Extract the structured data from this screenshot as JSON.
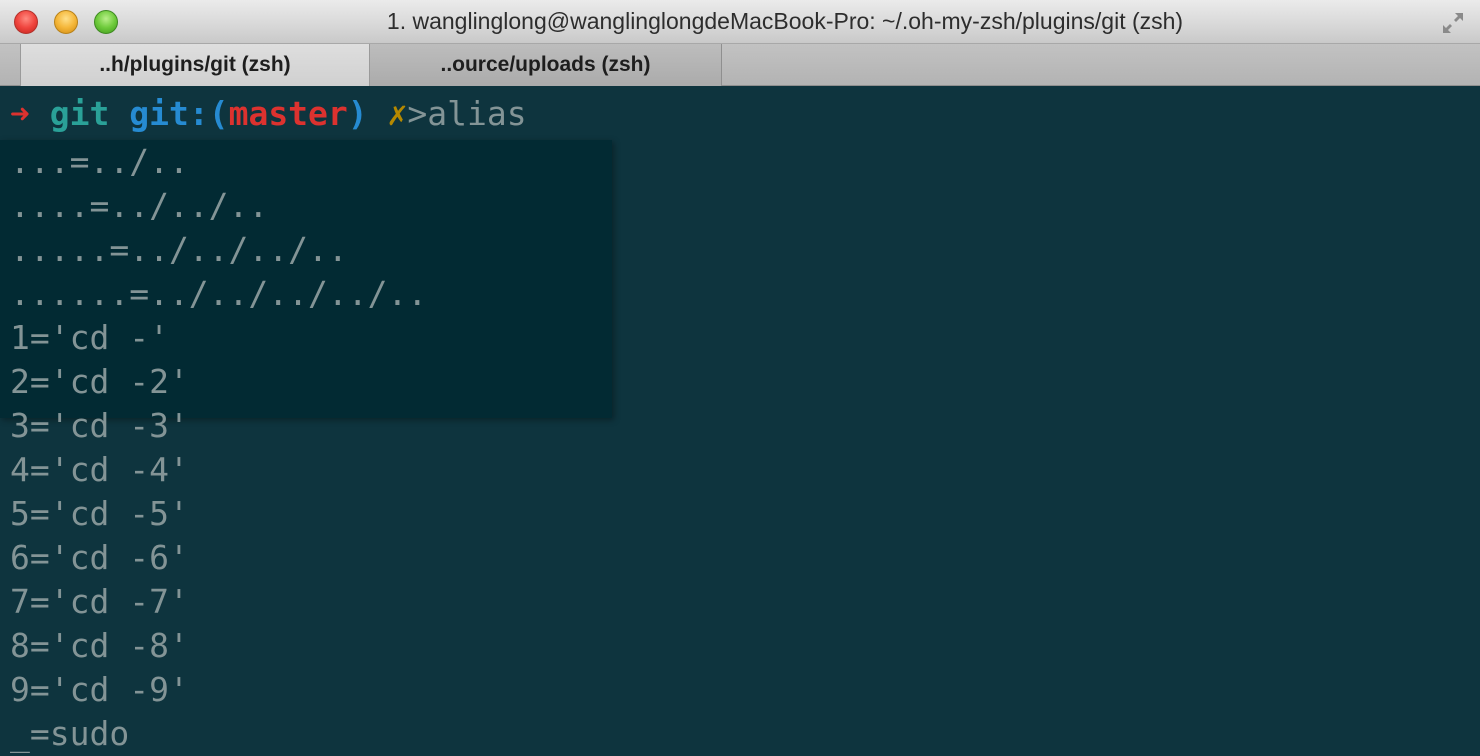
{
  "window": {
    "title": "1. wanglinglong@wanglinglongdeMacBook-Pro: ~/.oh-my-zsh/plugins/git (zsh)",
    "fullscreen_icon": "fullscreen-arrows-icon"
  },
  "tabs": [
    {
      "label": "..h/plugins/git (zsh)",
      "active": true
    },
    {
      "label": "..ource/uploads (zsh)",
      "active": false
    }
  ],
  "prompt": {
    "arrow": "➜",
    "dir": "git",
    "git_prefix": "git:(",
    "branch": "master",
    "git_suffix": ")",
    "dirty": "✗",
    "command": ">alias"
  },
  "output_lines": [
    "...=../..",
    "....=../../..",
    ".....=../../../..",
    "......=../../../../..",
    "1='cd -'",
    "2='cd -2'",
    "3='cd -3'",
    "4='cd -4'",
    "5='cd -5'",
    "6='cd -6'",
    "7='cd -7'",
    "8='cd -8'",
    "9='cd -9'",
    "_=sudo"
  ],
  "colors": {
    "background": "#0e343e",
    "highlight": "#022a33",
    "text": "#839496",
    "red": "#dc322f",
    "cyan": "#2aa198",
    "blue": "#268bd2",
    "yellow": "#b58900"
  }
}
